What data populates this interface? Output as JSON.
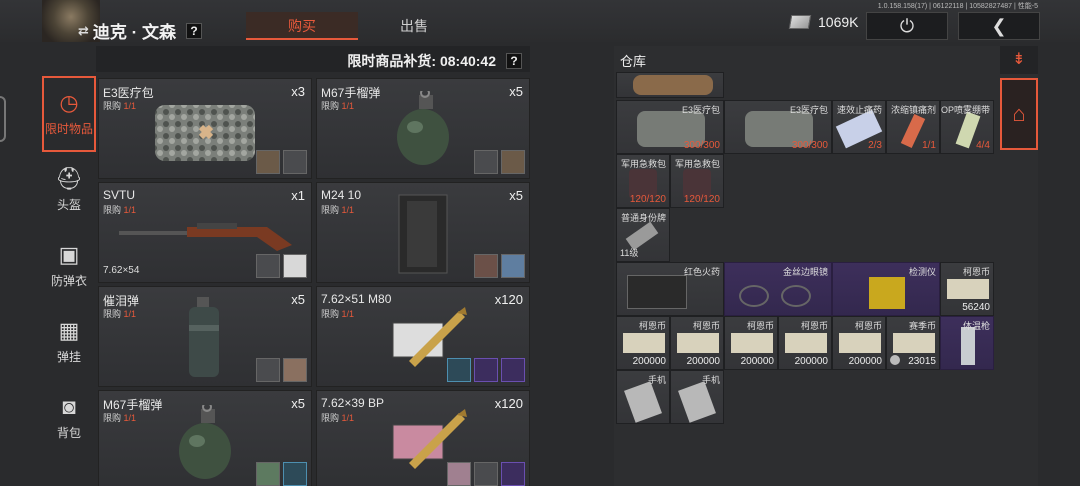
{
  "player": {
    "name": "迪克 · 文森"
  },
  "tabs": [
    {
      "label": "购买"
    },
    {
      "label": "出售"
    }
  ],
  "currency": {
    "amount": "1069K"
  },
  "version_text": "1.0.158.158(17) | 06122118 | 10582827487 | 性能-5",
  "help_mark": "?",
  "categories": [
    {
      "label": "限时物品",
      "icon": "clock-icon"
    },
    {
      "label": "头盔",
      "icon": "helmet-icon"
    },
    {
      "label": "防弹衣",
      "icon": "vest-icon"
    },
    {
      "label": "弹挂",
      "icon": "chest-rig-icon"
    },
    {
      "label": "背包",
      "icon": "backpack-icon"
    }
  ],
  "shop": {
    "restock_text": "限时商品补货: 08:40:42",
    "limit_prefix": "限购 ",
    "items": [
      {
        "name": "E3医疗包",
        "qty": "x3",
        "limit": "1/1",
        "caliber": ""
      },
      {
        "name": "M67手榴弹",
        "qty": "x5",
        "limit": "1/1",
        "caliber": ""
      },
      {
        "name": "SVTU",
        "qty": "x1",
        "limit": "1/1",
        "caliber": "7.62×54"
      },
      {
        "name": "M24 10",
        "qty": "x5",
        "limit": "1/1",
        "caliber": ""
      },
      {
        "name": "催泪弹",
        "qty": "x5",
        "limit": "1/1",
        "caliber": ""
      },
      {
        "name": "7.62×51 M80",
        "qty": "x120",
        "limit": "1/1",
        "caliber": ""
      },
      {
        "name": "M67手榴弹",
        "qty": "x5",
        "limit": "1/1",
        "caliber": ""
      },
      {
        "name": "7.62×39 BP",
        "qty": "x120",
        "limit": "1/1",
        "caliber": ""
      }
    ]
  },
  "warehouse": {
    "title": "仓库",
    "cells": [
      {
        "label": "E3医疗包",
        "count": "300/300",
        "count_style": "red",
        "level": ""
      },
      {
        "label": "E3医疗包",
        "count": "300/300",
        "count_style": "red",
        "level": ""
      },
      {
        "label": "速效止痛药",
        "count": "2/3",
        "count_style": "red",
        "level": ""
      },
      {
        "label": "浓缩镇痛剂",
        "count": "1/1",
        "count_style": "red",
        "level": ""
      },
      {
        "label": "OP喷雾绷带",
        "count": "4/4",
        "count_style": "red",
        "level": ""
      },
      {
        "label": "军用急救包",
        "count": "120/120",
        "count_style": "red",
        "level": ""
      },
      {
        "label": "军用急救包",
        "count": "120/120",
        "count_style": "red",
        "level": ""
      },
      {
        "label": "普通身份牌",
        "count": "",
        "count_style": "white",
        "level": "11级"
      },
      {
        "label": "红色火药",
        "count": "",
        "count_style": "white",
        "level": ""
      },
      {
        "label": "金丝边眼镜",
        "count": "",
        "count_style": "white",
        "level": ""
      },
      {
        "label": "检测仪",
        "count": "",
        "count_style": "white",
        "level": ""
      },
      {
        "label": "柯恩币",
        "count": "56240",
        "count_style": "white",
        "level": ""
      },
      {
        "label": "柯恩币",
        "count": "200000",
        "count_style": "white",
        "level": ""
      },
      {
        "label": "柯恩币",
        "count": "200000",
        "count_style": "white",
        "level": ""
      },
      {
        "label": "柯恩币",
        "count": "200000",
        "count_style": "white",
        "level": ""
      },
      {
        "label": "柯恩币",
        "count": "200000",
        "count_style": "white",
        "level": ""
      },
      {
        "label": "柯恩币",
        "count": "200000",
        "count_style": "white",
        "level": ""
      },
      {
        "label": "赛季币",
        "count": "23015",
        "count_style": "white",
        "level": ""
      },
      {
        "label": "体温枪",
        "count": "",
        "count_style": "white",
        "level": ""
      },
      {
        "label": "手机",
        "count": "",
        "count_style": "white",
        "level": ""
      },
      {
        "label": "手机",
        "count": "",
        "count_style": "white",
        "level": ""
      }
    ]
  },
  "colors": {
    "accent": "#e7593b",
    "limit_value": "#e7593b",
    "rare_slot": "#3d2f5b"
  }
}
